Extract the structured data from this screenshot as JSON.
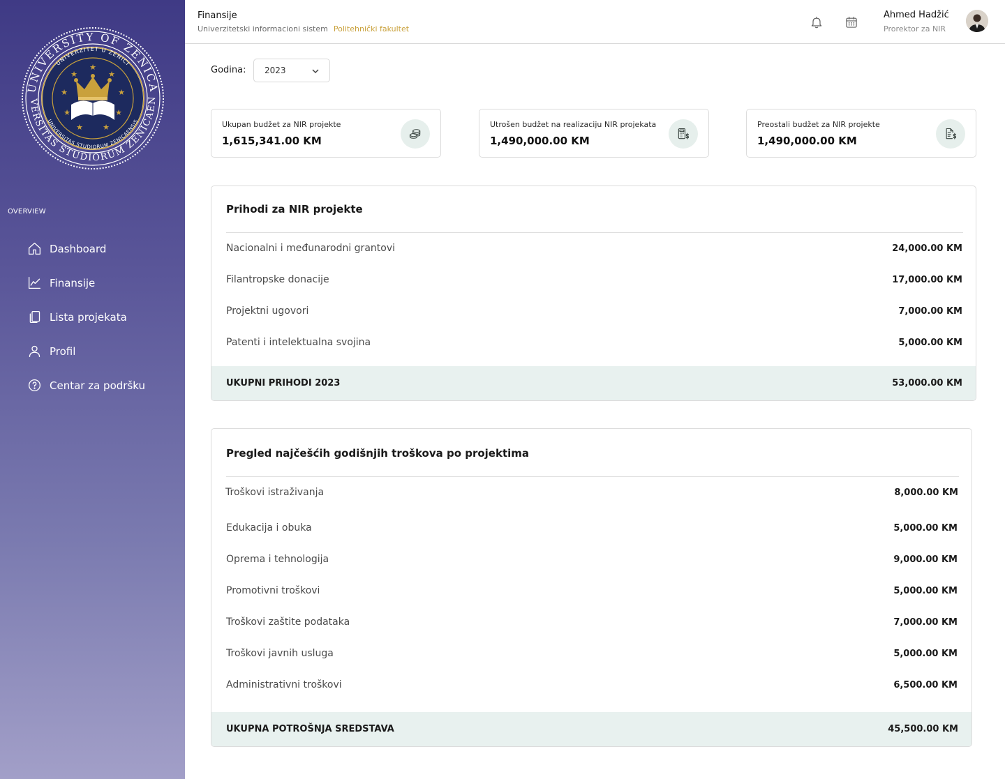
{
  "sidebar": {
    "section_label": "OVERVIEW",
    "items": [
      {
        "label": "Dashboard",
        "icon": "home-icon"
      },
      {
        "label": "Finansije",
        "icon": "chart-line-icon"
      },
      {
        "label": "Lista projekata",
        "icon": "documents-icon"
      },
      {
        "label": "Profil",
        "icon": "user-icon"
      },
      {
        "label": "Centar za podršku",
        "icon": "help-circle-icon"
      }
    ],
    "logo": {
      "outer_text": "UNIVERSITY OF ZENICA · UNIVERSITAS STUDIORUM ZENICAENSIS",
      "inner_text": "UNIVERZITET U ZENICI · UNIVERSITAS STUDIORUM ZENICAENSIS"
    }
  },
  "header": {
    "title": "Finansije",
    "subtitle": "Univerzitetski informacioni sistem",
    "faculty": "Politehnički fakultet",
    "user_name": "Ahmed Hadžić",
    "user_role": "Prorektor za NIR",
    "icons": [
      "bell-icon",
      "calendar-icon"
    ]
  },
  "filter": {
    "year_label": "Godina:",
    "year_value": "2023"
  },
  "stats": [
    {
      "label": "Ukupan budžet za NIR projekte",
      "value": "1,615,341.00 KM",
      "icon": "coins-icon"
    },
    {
      "label": "Utrošen budžet na realizaciju NIR projekata",
      "value": "1,490,000.00 KM",
      "icon": "calculator-dollar-icon"
    },
    {
      "label": "Preostali budžet za NIR projekte",
      "value": "1,490,000.00 KM",
      "icon": "document-dollar-icon"
    }
  ],
  "income": {
    "title": "Prihodi za NIR projekte",
    "rows": [
      {
        "name": "Nacionalni i međunarodni grantovi",
        "amount": "24,000.00 KM"
      },
      {
        "name": "Filantropske donacije",
        "amount": "17,000.00 KM"
      },
      {
        "name": "Projektni ugovori",
        "amount": "7,000.00 KM"
      },
      {
        "name": "Patenti i intelektualna svojina",
        "amount": "5,000.00 KM"
      }
    ],
    "total_label": "UKUPNI PRIHODI 2023",
    "total_amount": "53,000.00 KM"
  },
  "costs": {
    "title": "Pregled najčešćih godišnjih troškova po projektima",
    "rows": [
      {
        "name": "Troškovi istraživanja",
        "amount": "8,000.00 KM"
      },
      {
        "name": "Edukacija i obuka",
        "amount": "5,000.00 KM"
      },
      {
        "name": "Oprema i tehnologija",
        "amount": "9,000.00 KM"
      },
      {
        "name": "Promotivni troškovi",
        "amount": "5,000.00 KM"
      },
      {
        "name": "Troškovi zaštite podataka",
        "amount": "7,000.00 KM"
      },
      {
        "name": "Troškovi javnih usluga",
        "amount": "5,000.00 KM"
      },
      {
        "name": "Administrativni troškovi",
        "amount": "6,500.00 KM"
      }
    ],
    "total_label": "UKUPNA POTROŠNJA SREDSTAVA",
    "total_amount": "45,500.00 KM"
  },
  "colors": {
    "sidebar_top": "#3f3a85",
    "sidebar_bottom": "#a29fc8",
    "accent_gold": "#c9a13c",
    "total_row_bg": "#e8f1ef",
    "icon_circle_bg": "#e6efec",
    "seal_navy": "#1d2a5e"
  }
}
